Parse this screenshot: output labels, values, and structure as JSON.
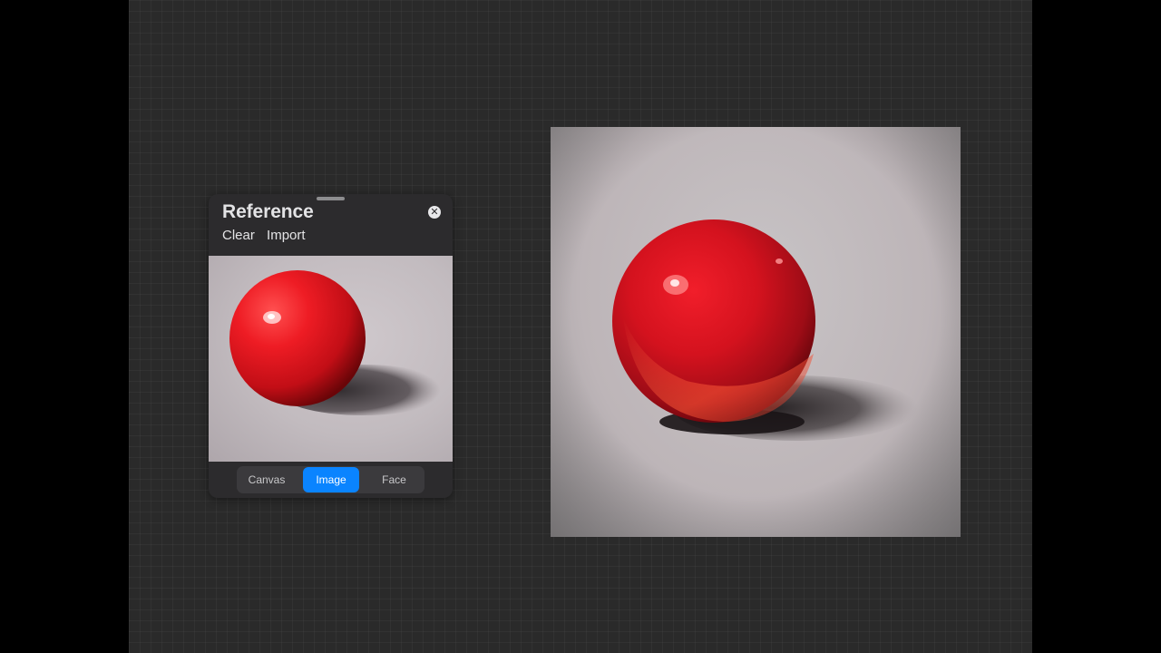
{
  "reference_panel": {
    "title": "Reference",
    "actions": [
      "Clear",
      "Import"
    ],
    "close_icon": "close-icon",
    "modes": [
      {
        "label": "Canvas",
        "active": false
      },
      {
        "label": "Image",
        "active": true
      },
      {
        "label": "Face",
        "active": false
      }
    ]
  },
  "colors": {
    "workspace_bg": "#2a2a2a",
    "panel_bg": "#2c2b2d",
    "accent": "#0a84ff",
    "ball_red": "#e3121c"
  }
}
